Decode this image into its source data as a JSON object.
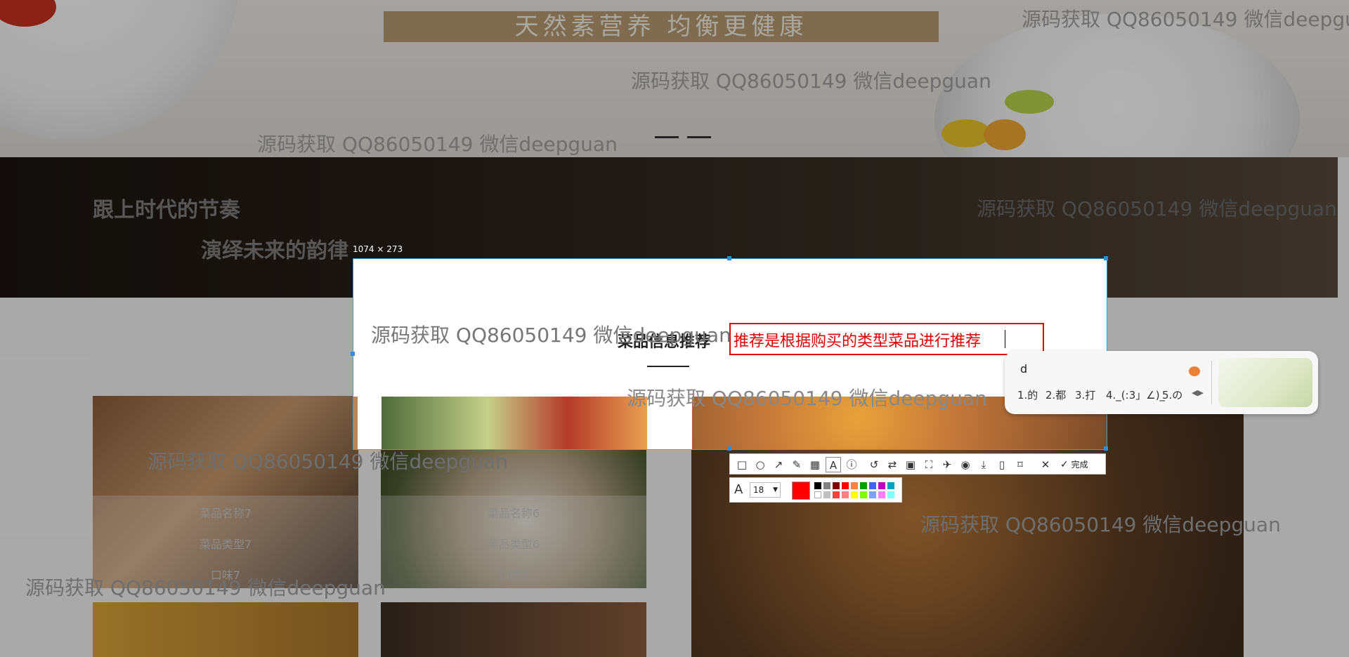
{
  "banner": {
    "slogan": "天然素营养 均衡更健康"
  },
  "music_band": {
    "line1": "跟上时代的节奏",
    "line2": "演绎未来的韵律"
  },
  "section": {
    "title": "菜品信息推荐"
  },
  "annotation": {
    "size_label": "1074 × 273",
    "text": "推荐是根据购买的类型菜品进行推荐"
  },
  "cards": [
    {
      "name": "菜品名称7",
      "type": "菜品类型7",
      "taste": "口味7"
    },
    {
      "name": "菜品名称6",
      "type": "菜品类型6",
      "taste": "口味6"
    }
  ],
  "watermark": "源码获取 QQ86050149 微信deepguan",
  "toolbar": {
    "done_label": "完成",
    "icons": [
      "rectangle-icon",
      "ellipse-icon",
      "arrow-icon",
      "pen-icon",
      "mosaic-icon",
      "text-icon",
      "number-icon",
      "undo-icon",
      "translate-icon",
      "ocr-icon",
      "long-screenshot-icon",
      "pin-icon",
      "record-icon",
      "save-icon",
      "mobile-icon",
      "bookmark-icon",
      "close-icon",
      "check-icon"
    ]
  },
  "style_bar": {
    "font_size": "18",
    "selected_color": "#ff0000",
    "palette": [
      "#000000",
      "#808080",
      "#800000",
      "#ff0000",
      "#ff8040",
      "#00a000",
      "#4060ff",
      "#c000c0",
      "#00a0c0",
      "#ffffff",
      "#c0c0c0",
      "#ff4040",
      "#ff8080",
      "#ffff00",
      "#80ff00",
      "#80a0ff",
      "#ff80ff",
      "#80ffff"
    ]
  },
  "ime": {
    "input": "d",
    "candidates": [
      "1.的",
      "2.都",
      "3.打",
      "4._(:3」∠)_",
      "5.の"
    ]
  }
}
